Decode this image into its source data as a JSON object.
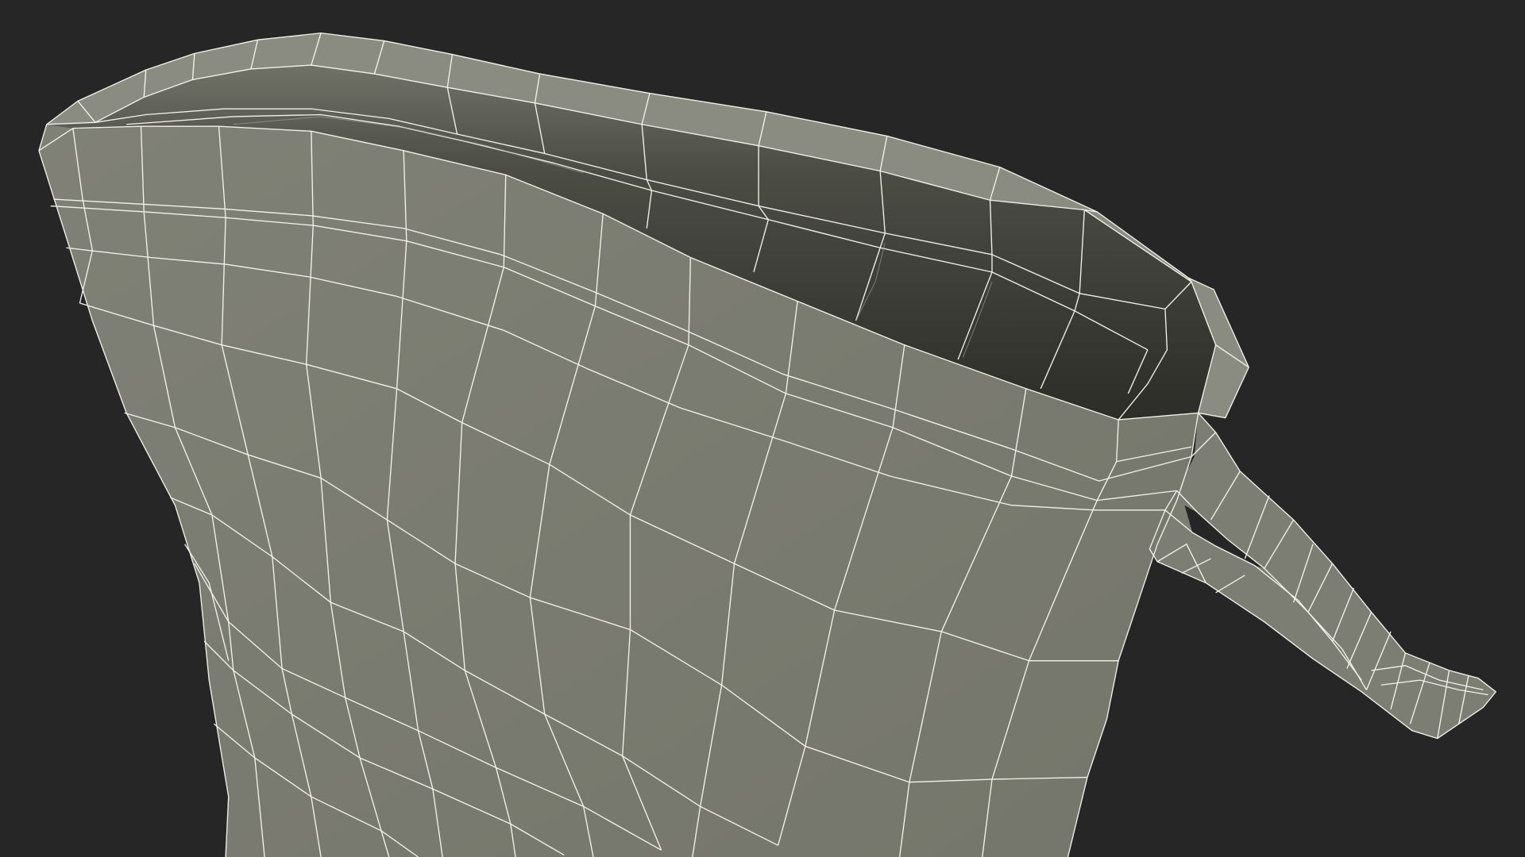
{
  "scene": {
    "background_color": "#262626",
    "mesh_color": "#7a7b70",
    "mesh_dark_color": "#3a3b34",
    "wire_color": "#f2f2ea",
    "object": "boot-wireframe-mesh"
  }
}
